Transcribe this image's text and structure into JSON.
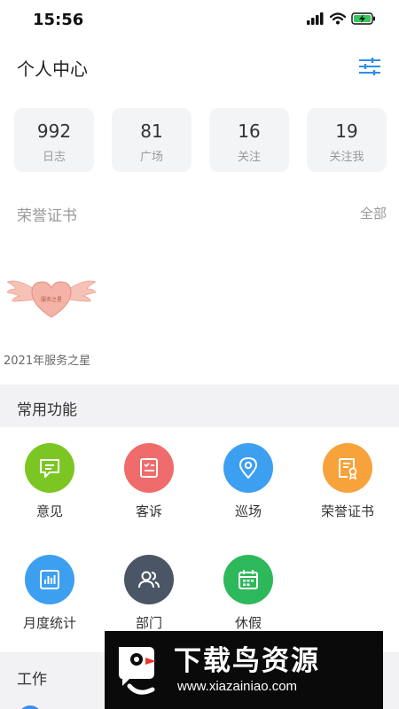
{
  "status_bar": {
    "time": "15:56"
  },
  "header": {
    "title": "个人中心"
  },
  "stats": [
    {
      "value": "992",
      "label": "日志"
    },
    {
      "value": "81",
      "label": "广场"
    },
    {
      "value": "16",
      "label": "关注"
    },
    {
      "value": "19",
      "label": "关注我"
    }
  ],
  "honors": {
    "title": "荣誉证书",
    "view_all": "全部",
    "badge_caption": "2021年服务之星",
    "badge_text": "服务之星"
  },
  "common_functions": {
    "title": "常用功能",
    "items": [
      {
        "label": "意见",
        "color": "#7cc623",
        "icon": "message-icon"
      },
      {
        "label": "客诉",
        "color": "#f06b6b",
        "icon": "checklist-icon"
      },
      {
        "label": "巡场",
        "color": "#3d9ff0",
        "icon": "location-pin-icon"
      },
      {
        "label": "荣誉证书",
        "color": "#f7a23a",
        "icon": "certificate-icon"
      },
      {
        "label": "月度统计",
        "color": "#3d9ff0",
        "icon": "bar-chart-icon"
      },
      {
        "label": "部门",
        "color": "#4a5566",
        "icon": "people-icon"
      },
      {
        "label": "休假",
        "color": "#2eb85c",
        "icon": "calendar-icon"
      }
    ]
  },
  "work": {
    "title": "工作"
  },
  "watermark": {
    "title": "下载鸟资源",
    "url": "www.xiazainiao.com"
  }
}
